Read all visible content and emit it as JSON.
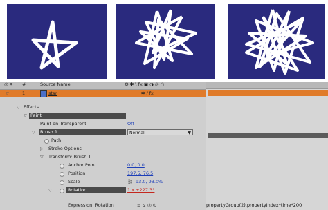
{
  "colors": {
    "comp_bg": "#2a2a7e",
    "selected_row": "#e07b2a",
    "value_blue": "#1d3fb8",
    "value_red": "#c4271e"
  },
  "header": {
    "hash": "#",
    "source_name_col": "Source Name",
    "switch_icons": "⚙ ✱ \\ fx ▣ ◑ ◎ ○"
  },
  "layer": {
    "number": "1",
    "name": "star",
    "switches": "✱ / fx"
  },
  "effects": {
    "label": "Effects",
    "paint_label": "Paint",
    "paint_on_transparent": {
      "label": "Paint on Transparent",
      "value": "Off"
    },
    "brush": {
      "label": "Brush 1",
      "mode": "Normal"
    },
    "path_label": "Path",
    "stroke_options_label": "Stroke Options",
    "transform_label": "Transform: Brush 1",
    "anchor_point": {
      "label": "Anchor Point",
      "value": "0.0, 0.0"
    },
    "position": {
      "label": "Position",
      "value": "197.5, 76.5"
    },
    "scale": {
      "label": "Scale",
      "value": "93.0, 93.0%"
    },
    "rotation": {
      "label": "Rotation",
      "value": "1 x +227.3°"
    },
    "expression": {
      "label": "Expression: Rotation",
      "text": "propertyGroup(2).propertyIndex*time*200"
    }
  }
}
